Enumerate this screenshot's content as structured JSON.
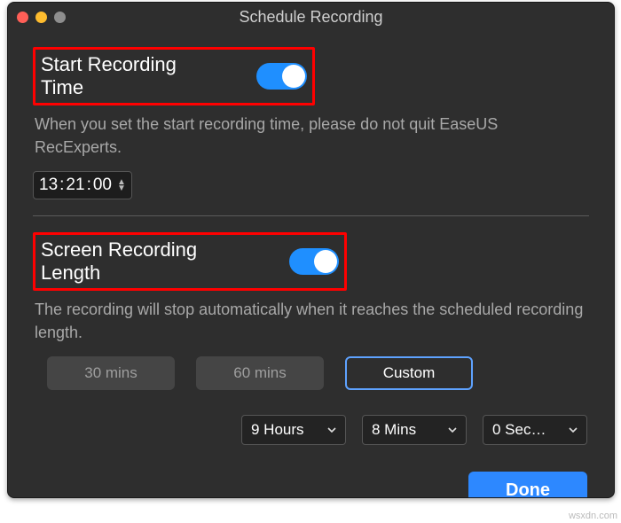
{
  "window": {
    "title": "Schedule Recording"
  },
  "start": {
    "title": "Start Recording Time",
    "enabled": true,
    "desc": "When you set the start recording time, please do not quit EaseUS RecExperts.",
    "time": {
      "h": "13",
      "m": "21",
      "s": "00"
    }
  },
  "length": {
    "title": "Screen Recording Length",
    "enabled": true,
    "desc": "The recording will stop automatically when it reaches the scheduled recording length.",
    "presets": [
      "30 mins",
      "60 mins",
      "Custom"
    ],
    "selected": "Custom",
    "custom": {
      "hours": "9 Hours",
      "mins": "8 Mins",
      "secs": "0 Sec…"
    }
  },
  "footer": {
    "done": "Done"
  },
  "watermark": "wsxdn.com"
}
